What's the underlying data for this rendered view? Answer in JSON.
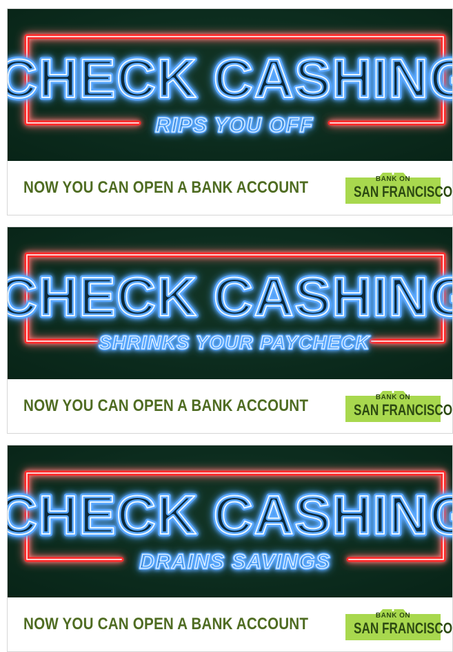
{
  "colors": {
    "neon_blue": "#7fc4ff",
    "neon_red": "#ff3a3a",
    "panel_green": "#0c2c1e",
    "tagline_green": "#4f6c22",
    "logo_green": "#a8d84e",
    "logo_text": "#2d4a12"
  },
  "icons": {
    "neon_frame": "neon-sign-frame",
    "logo_badge": "badge-shape"
  },
  "banners": [
    {
      "title": "CHECK CASHING",
      "subtitle": "RIPS YOU OFF",
      "tagline": "NOW YOU CAN OPEN A BANK ACCOUNT",
      "logo": {
        "top_line": "BANK ON",
        "main_line": "SAN FRANCISCO"
      }
    },
    {
      "title": "CHECK CASHING",
      "subtitle": "SHRINKS YOUR PAYCHECK",
      "tagline": "NOW YOU CAN OPEN A BANK ACCOUNT",
      "logo": {
        "top_line": "BANK ON",
        "main_line": "SAN FRANCISCO"
      }
    },
    {
      "title": "CHECK CASHING",
      "subtitle": "DRAINS SAVINGS",
      "tagline": "NOW YOU CAN OPEN A BANK ACCOUNT",
      "logo": {
        "top_line": "BANK ON",
        "main_line": "SAN FRANCISCO"
      }
    }
  ]
}
